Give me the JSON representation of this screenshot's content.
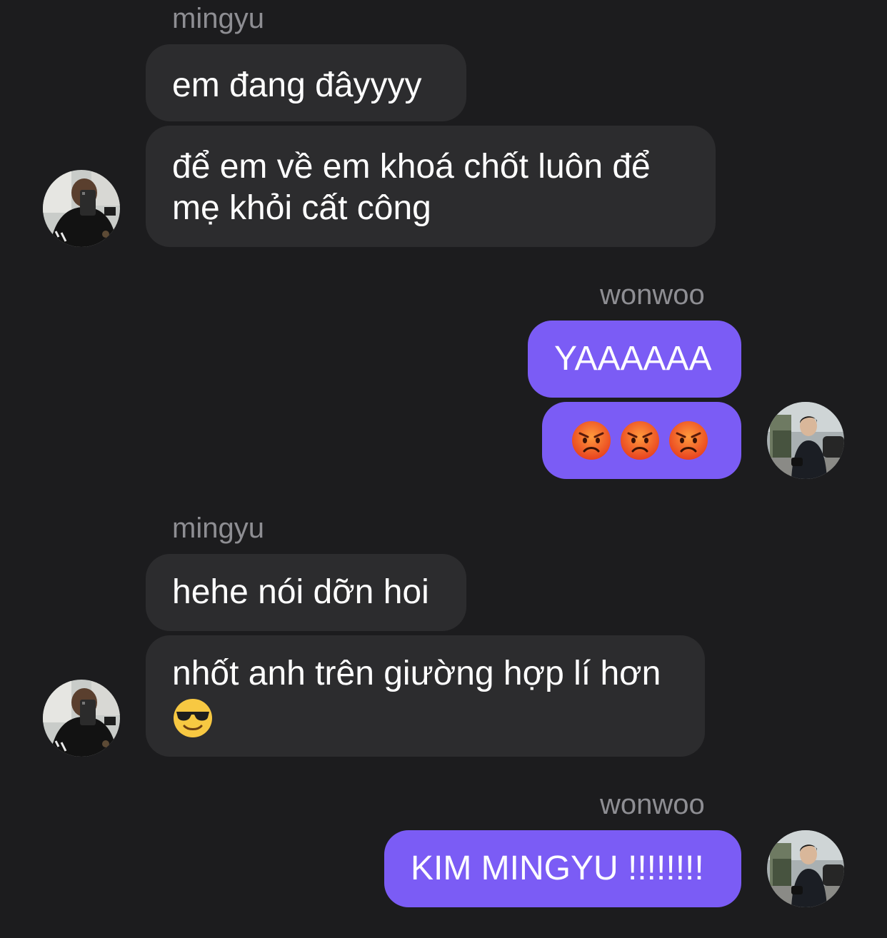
{
  "conversation": {
    "groups": [
      {
        "sender": "mingyu",
        "messages": [
          "em đang đâyyyy",
          "để em về em khoá chốt luôn để",
          "mẹ khỏi cất công"
        ]
      },
      {
        "sender": "wonwoo",
        "messages": [
          "YAAAAAA"
        ],
        "emoji_count": 3
      },
      {
        "sender": "mingyu",
        "messages": [
          "hehe nói dỡn hoi",
          "nhốt anh trên giường hợp lí hơn"
        ]
      },
      {
        "sender": "wonwoo",
        "messages": [
          "KIM MINGYU !!!!!!!!"
        ]
      }
    ]
  },
  "colors": {
    "background": "#1c1c1e",
    "incoming_bubble": "#2c2c2e",
    "outgoing_bubble": "#7b5cf5",
    "sender_label": "#8e8e93"
  },
  "icons": {
    "angry": "angry-face-icon",
    "cool": "smiling-face-with-sunglasses-icon"
  }
}
